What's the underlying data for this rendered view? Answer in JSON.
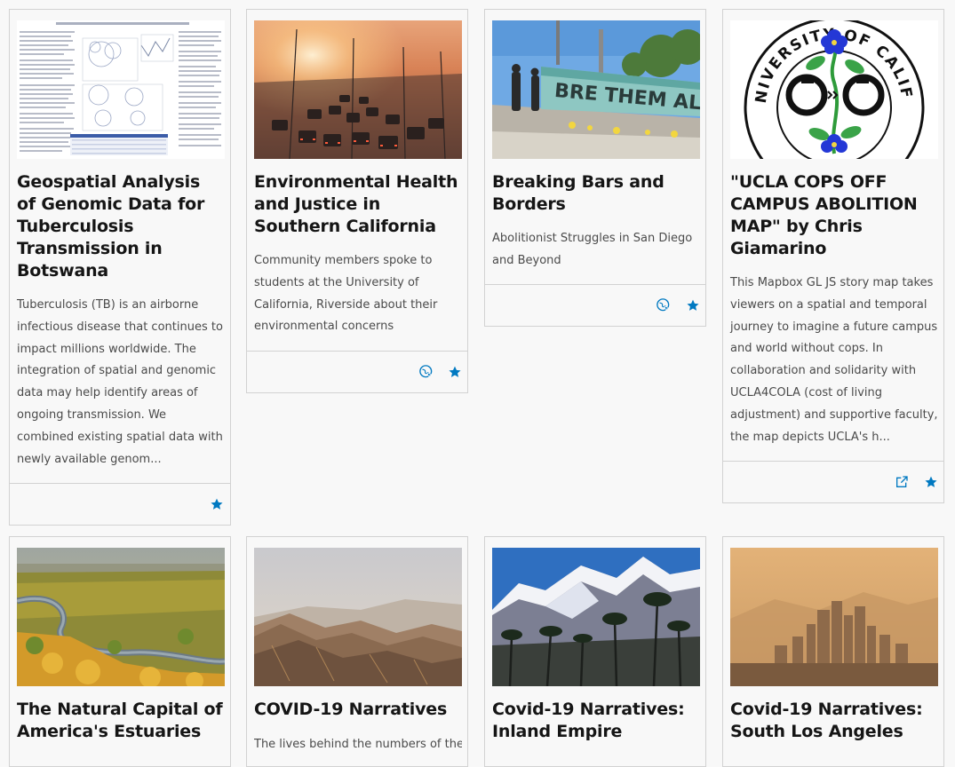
{
  "accent_color": "#0079c1",
  "cards": [
    {
      "title": "Geospatial Analysis of Genomic Data for Tuberculosis Transmission in Botswana",
      "snippet": "Tuberculosis (TB) is an airborne infectious disease that continues to impact millions worldwide. The integration of spatial and genomic data may help identify areas of ongoing transmission. We combined existing spatial data with newly available genom...",
      "thumbnail": "research-poster",
      "icons": [
        "star-icon"
      ]
    },
    {
      "title": "Environmental Health and Justice in Southern California",
      "snippet": "Community members spoke to students at the University of California, Riverside about their environmental concerns",
      "thumbnail": "freeway-traffic-sunset",
      "icons": [
        "globe-pointer-icon",
        "star-icon"
      ]
    },
    {
      "title": "Breaking Bars and Borders",
      "snippet": "Abolitionist Struggles in San Diego and Beyond",
      "thumbnail": "protest-banner",
      "icons": [
        "globe-pointer-icon",
        "star-icon"
      ]
    },
    {
      "title": "\"UCLA COPS OFF CAMPUS ABOLITION MAP\" by Chris Giamarino",
      "snippet": "This Mapbox GL JS story map takes viewers on a spatial and temporal journey to imagine a future campus and world without cops. In collaboration and solidarity with UCLA4COLA (cost of living adjustment) and supportive faculty, the map depicts UCLA's h...",
      "thumbnail": "university-seal-handcuffs",
      "seal_text": "THE UNIVERSITY OF CALIFORNIA",
      "icons": [
        "external-link-icon",
        "star-icon"
      ]
    },
    {
      "title": "The Natural Capital of America's Estuaries",
      "snippet": "",
      "thumbnail": "estuary-marsh",
      "icons": []
    },
    {
      "title": "COVID-19 Narratives",
      "snippet": "The lives behind the numbers of the",
      "thumbnail": "desert-hills",
      "icons": []
    },
    {
      "title": "Covid-19 Narratives: Inland Empire",
      "snippet": "",
      "thumbnail": "snowy-mountains-palms",
      "icons": []
    },
    {
      "title": "Covid-19 Narratives: South Los Angeles",
      "snippet": "",
      "thumbnail": "la-skyline-haze",
      "icons": []
    }
  ]
}
